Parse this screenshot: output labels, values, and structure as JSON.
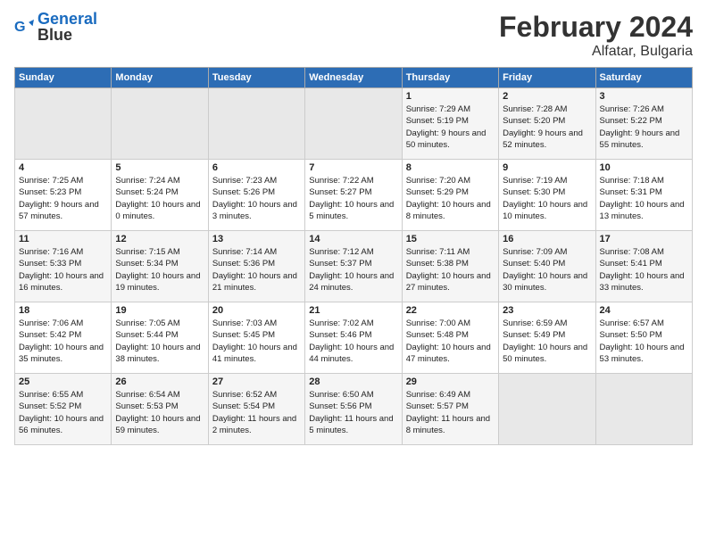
{
  "header": {
    "title": "February 2024",
    "subtitle": "Alfatar, Bulgaria"
  },
  "columns": [
    "Sunday",
    "Monday",
    "Tuesday",
    "Wednesday",
    "Thursday",
    "Friday",
    "Saturday"
  ],
  "weeks": [
    [
      {
        "day": "",
        "info": ""
      },
      {
        "day": "",
        "info": ""
      },
      {
        "day": "",
        "info": ""
      },
      {
        "day": "",
        "info": ""
      },
      {
        "day": "1",
        "info": "Sunrise: 7:29 AM\nSunset: 5:19 PM\nDaylight: 9 hours and 50 minutes."
      },
      {
        "day": "2",
        "info": "Sunrise: 7:28 AM\nSunset: 5:20 PM\nDaylight: 9 hours and 52 minutes."
      },
      {
        "day": "3",
        "info": "Sunrise: 7:26 AM\nSunset: 5:22 PM\nDaylight: 9 hours and 55 minutes."
      }
    ],
    [
      {
        "day": "4",
        "info": "Sunrise: 7:25 AM\nSunset: 5:23 PM\nDaylight: 9 hours and 57 minutes."
      },
      {
        "day": "5",
        "info": "Sunrise: 7:24 AM\nSunset: 5:24 PM\nDaylight: 10 hours and 0 minutes."
      },
      {
        "day": "6",
        "info": "Sunrise: 7:23 AM\nSunset: 5:26 PM\nDaylight: 10 hours and 3 minutes."
      },
      {
        "day": "7",
        "info": "Sunrise: 7:22 AM\nSunset: 5:27 PM\nDaylight: 10 hours and 5 minutes."
      },
      {
        "day": "8",
        "info": "Sunrise: 7:20 AM\nSunset: 5:29 PM\nDaylight: 10 hours and 8 minutes."
      },
      {
        "day": "9",
        "info": "Sunrise: 7:19 AM\nSunset: 5:30 PM\nDaylight: 10 hours and 10 minutes."
      },
      {
        "day": "10",
        "info": "Sunrise: 7:18 AM\nSunset: 5:31 PM\nDaylight: 10 hours and 13 minutes."
      }
    ],
    [
      {
        "day": "11",
        "info": "Sunrise: 7:16 AM\nSunset: 5:33 PM\nDaylight: 10 hours and 16 minutes."
      },
      {
        "day": "12",
        "info": "Sunrise: 7:15 AM\nSunset: 5:34 PM\nDaylight: 10 hours and 19 minutes."
      },
      {
        "day": "13",
        "info": "Sunrise: 7:14 AM\nSunset: 5:36 PM\nDaylight: 10 hours and 21 minutes."
      },
      {
        "day": "14",
        "info": "Sunrise: 7:12 AM\nSunset: 5:37 PM\nDaylight: 10 hours and 24 minutes."
      },
      {
        "day": "15",
        "info": "Sunrise: 7:11 AM\nSunset: 5:38 PM\nDaylight: 10 hours and 27 minutes."
      },
      {
        "day": "16",
        "info": "Sunrise: 7:09 AM\nSunset: 5:40 PM\nDaylight: 10 hours and 30 minutes."
      },
      {
        "day": "17",
        "info": "Sunrise: 7:08 AM\nSunset: 5:41 PM\nDaylight: 10 hours and 33 minutes."
      }
    ],
    [
      {
        "day": "18",
        "info": "Sunrise: 7:06 AM\nSunset: 5:42 PM\nDaylight: 10 hours and 35 minutes."
      },
      {
        "day": "19",
        "info": "Sunrise: 7:05 AM\nSunset: 5:44 PM\nDaylight: 10 hours and 38 minutes."
      },
      {
        "day": "20",
        "info": "Sunrise: 7:03 AM\nSunset: 5:45 PM\nDaylight: 10 hours and 41 minutes."
      },
      {
        "day": "21",
        "info": "Sunrise: 7:02 AM\nSunset: 5:46 PM\nDaylight: 10 hours and 44 minutes."
      },
      {
        "day": "22",
        "info": "Sunrise: 7:00 AM\nSunset: 5:48 PM\nDaylight: 10 hours and 47 minutes."
      },
      {
        "day": "23",
        "info": "Sunrise: 6:59 AM\nSunset: 5:49 PM\nDaylight: 10 hours and 50 minutes."
      },
      {
        "day": "24",
        "info": "Sunrise: 6:57 AM\nSunset: 5:50 PM\nDaylight: 10 hours and 53 minutes."
      }
    ],
    [
      {
        "day": "25",
        "info": "Sunrise: 6:55 AM\nSunset: 5:52 PM\nDaylight: 10 hours and 56 minutes."
      },
      {
        "day": "26",
        "info": "Sunrise: 6:54 AM\nSunset: 5:53 PM\nDaylight: 10 hours and 59 minutes."
      },
      {
        "day": "27",
        "info": "Sunrise: 6:52 AM\nSunset: 5:54 PM\nDaylight: 11 hours and 2 minutes."
      },
      {
        "day": "28",
        "info": "Sunrise: 6:50 AM\nSunset: 5:56 PM\nDaylight: 11 hours and 5 minutes."
      },
      {
        "day": "29",
        "info": "Sunrise: 6:49 AM\nSunset: 5:57 PM\nDaylight: 11 hours and 8 minutes."
      },
      {
        "day": "",
        "info": ""
      },
      {
        "day": "",
        "info": ""
      }
    ]
  ]
}
